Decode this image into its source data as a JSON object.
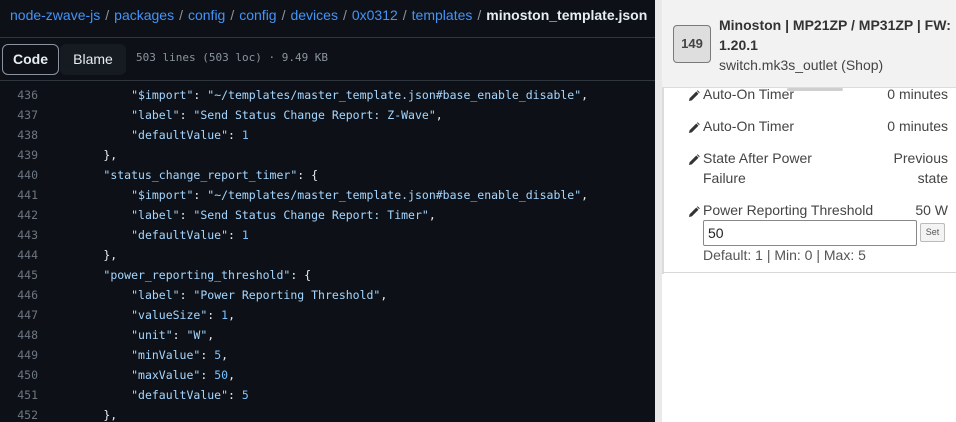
{
  "breadcrumb": {
    "parts": [
      "node-zwave-js",
      "packages",
      "config",
      "config",
      "devices",
      "0x0312",
      "templates"
    ],
    "current": "minoston_template.json"
  },
  "toolbar": {
    "code_label": "Code",
    "blame_label": "Blame",
    "file_info": "503 lines (503 loc) · 9.49 KB"
  },
  "code": [
    {
      "n": "436",
      "t": "            \"$import\": \"~/templates/master_template.json#base_enable_disable\","
    },
    {
      "n": "437",
      "t": "            \"label\": \"Send Status Change Report: Z-Wave\","
    },
    {
      "n": "438",
      "t": "            \"defaultValue\": 1"
    },
    {
      "n": "439",
      "t": "        },"
    },
    {
      "n": "440",
      "t": "        \"status_change_report_timer\": {"
    },
    {
      "n": "441",
      "t": "            \"$import\": \"~/templates/master_template.json#base_enable_disable\","
    },
    {
      "n": "442",
      "t": "            \"label\": \"Send Status Change Report: Timer\","
    },
    {
      "n": "443",
      "t": "            \"defaultValue\": 1"
    },
    {
      "n": "444",
      "t": "        },"
    },
    {
      "n": "445",
      "t": "        \"power_reporting_threshold\": {"
    },
    {
      "n": "446",
      "t": "            \"label\": \"Power Reporting Threshold\","
    },
    {
      "n": "447",
      "t": "            \"valueSize\": 1,"
    },
    {
      "n": "448",
      "t": "            \"unit\": \"W\","
    },
    {
      "n": "449",
      "t": "            \"minValue\": 5,"
    },
    {
      "n": "450",
      "t": "            \"maxValue\": 50,"
    },
    {
      "n": "451",
      "t": "            \"defaultValue\": 5"
    },
    {
      "n": "452",
      "t": "        },"
    }
  ],
  "device": {
    "node_id": "149",
    "title": "Minoston | MP21ZP / MP31ZP | FW: 1.20.1",
    "subtitle": "switch.mk3s_outlet (Shop)"
  },
  "settings": [
    {
      "label": "Auto-On Timer",
      "value": "0 minutes",
      "clipped": true
    },
    {
      "label": "Auto-On Timer",
      "value": "0 minutes"
    },
    {
      "label": "State After Power Failure",
      "value": "Previous state"
    },
    {
      "label": "Power Reporting Threshold",
      "value": "50 W"
    }
  ],
  "editor": {
    "input_value": "50",
    "set_label": "Set",
    "hint": "Default: 1 | Min: 0 | Max: 5"
  },
  "colors": {
    "code_bg": "#0d1117",
    "link": "#4493f8",
    "string": "#a5d6ff",
    "panel_bg": "#f2f2f2"
  }
}
